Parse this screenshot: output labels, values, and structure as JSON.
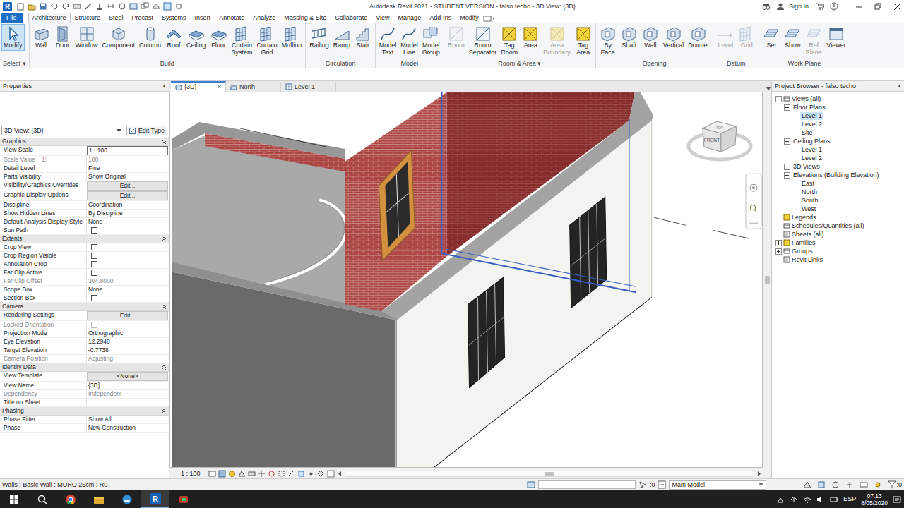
{
  "window": {
    "title": "Autodesk Revit 2021 - STUDENT VERSION - falso techo - 3D View: {3D}",
    "logo": "R",
    "sign_in": "Sign In"
  },
  "ribbon": {
    "app_button": {
      "label": "File"
    },
    "tabs": [
      {
        "label": "Architecture",
        "selected": true
      },
      {
        "label": "Structure",
        "selected": false
      },
      {
        "label": "Steel",
        "selected": false
      },
      {
        "label": "Precast",
        "selected": false
      },
      {
        "label": "Systems",
        "selected": false
      },
      {
        "label": "Insert",
        "selected": false
      },
      {
        "label": "Annotate",
        "selected": false
      },
      {
        "label": "Analyze",
        "selected": false
      },
      {
        "label": "Massing & Site",
        "selected": false
      },
      {
        "label": "Collaborate",
        "selected": false
      },
      {
        "label": "View",
        "selected": false
      },
      {
        "label": "Manage",
        "selected": false
      },
      {
        "label": "Add-Ins",
        "selected": false
      },
      {
        "label": "Modify",
        "selected": false
      }
    ],
    "panels": [
      {
        "label": "Select ▾",
        "buttons": [
          {
            "label": "Modify",
            "selected": true,
            "disabled": false
          }
        ]
      },
      {
        "label": "Build",
        "buttons": [
          {
            "label": "Wall",
            "selected": false,
            "disabled": false
          },
          {
            "label": "Door",
            "selected": false,
            "disabled": false
          },
          {
            "label": "Window",
            "selected": false,
            "disabled": false
          },
          {
            "label": "Component",
            "selected": false,
            "disabled": false
          },
          {
            "label": "Column",
            "selected": false,
            "disabled": false
          },
          {
            "label": "Roof",
            "selected": false,
            "disabled": false
          },
          {
            "label": "Ceiling",
            "selected": false,
            "disabled": false
          },
          {
            "label": "Floor",
            "selected": false,
            "disabled": false
          },
          {
            "label": "Curtain System",
            "selected": false,
            "disabled": false
          },
          {
            "label": "Curtain Grid",
            "selected": false,
            "disabled": false
          },
          {
            "label": "Mullion",
            "selected": false,
            "disabled": false
          }
        ]
      },
      {
        "label": "Circulation",
        "buttons": [
          {
            "label": "Railing",
            "selected": false,
            "disabled": false
          },
          {
            "label": "Ramp",
            "selected": false,
            "disabled": false
          },
          {
            "label": "Stair",
            "selected": false,
            "disabled": false
          }
        ]
      },
      {
        "label": "Model",
        "buttons": [
          {
            "label": "Model Text",
            "selected": false,
            "disabled": false
          },
          {
            "label": "Model Line",
            "selected": false,
            "disabled": false
          },
          {
            "label": "Model Group",
            "selected": false,
            "disabled": false
          }
        ]
      },
      {
        "label": "Room & Area ▾",
        "buttons": [
          {
            "label": "Room",
            "selected": false,
            "disabled": true
          },
          {
            "label": "Room Separator",
            "selected": false,
            "disabled": false
          },
          {
            "label": "Tag Room",
            "selected": false,
            "disabled": false
          },
          {
            "label": "Area",
            "selected": false,
            "disabled": false
          },
          {
            "label": "Area Boundary",
            "selected": false,
            "disabled": true
          },
          {
            "label": "Tag Area",
            "selected": false,
            "disabled": false
          }
        ]
      },
      {
        "label": "Opening",
        "buttons": [
          {
            "label": "By Face",
            "selected": false,
            "disabled": false
          },
          {
            "label": "Shaft",
            "selected": false,
            "disabled": false
          },
          {
            "label": "Wall",
            "selected": false,
            "disabled": false
          },
          {
            "label": "Vertical",
            "selected": false,
            "disabled": false
          },
          {
            "label": "Dormer",
            "selected": false,
            "disabled": false
          }
        ]
      },
      {
        "label": "Datum",
        "buttons": [
          {
            "label": "Level",
            "selected": false,
            "disabled": true
          },
          {
            "label": "Grid",
            "selected": false,
            "disabled": true
          }
        ]
      },
      {
        "label": "Work Plane",
        "buttons": [
          {
            "label": "Set",
            "selected": false,
            "disabled": false
          },
          {
            "label": "Show",
            "selected": false,
            "disabled": false
          },
          {
            "label": "Ref Plane",
            "selected": false,
            "disabled": true
          },
          {
            "label": "Viewer",
            "selected": false,
            "disabled": false
          }
        ]
      }
    ]
  },
  "properties": {
    "title": "Properties",
    "close": "×",
    "type_selector": "3D View: {3D}",
    "edit_type": "Edit Type",
    "groups": [
      {
        "name": "Graphics",
        "rows": [
          {
            "label": "View Scale",
            "value": "1 : 100",
            "kind": "input",
            "disabled": false
          },
          {
            "label": "Scale Value    1:",
            "value": "100",
            "kind": "text",
            "disabled": true
          },
          {
            "label": "Detail Level",
            "value": "Fine",
            "kind": "text",
            "disabled": false
          },
          {
            "label": "Parts Visibility",
            "value": "Show Original",
            "kind": "text",
            "disabled": false
          },
          {
            "label": "Visibility/Graphics Overrides",
            "value": "Edit...",
            "kind": "button",
            "disabled": false
          },
          {
            "label": "Graphic Display Options",
            "value": "Edit...",
            "kind": "button",
            "disabled": false
          },
          {
            "label": "Discipline",
            "value": "Coordination",
            "kind": "text",
            "disabled": false
          },
          {
            "label": "Show Hidden Lines",
            "value": "By Discipline",
            "kind": "text",
            "disabled": false
          },
          {
            "label": "Default Analysis Display Style",
            "value": "None",
            "kind": "text",
            "disabled": false
          },
          {
            "label": "Sun Path",
            "checked": false,
            "kind": "check",
            "disabled": false
          }
        ]
      },
      {
        "name": "Extents",
        "rows": [
          {
            "label": "Crop View",
            "checked": false,
            "kind": "check",
            "disabled": false
          },
          {
            "label": "Crop Region Visible",
            "checked": false,
            "kind": "check",
            "disabled": false
          },
          {
            "label": "Annotation Crop",
            "checked": false,
            "kind": "check",
            "disabled": false
          },
          {
            "label": "Far Clip Active",
            "checked": false,
            "kind": "check",
            "disabled": false
          },
          {
            "label": "Far Clip Offset",
            "value": "304.8000",
            "kind": "text",
            "disabled": true
          },
          {
            "label": "Scope Box",
            "value": "None",
            "kind": "text",
            "disabled": false
          },
          {
            "label": "Section Box",
            "checked": false,
            "kind": "check",
            "disabled": false
          }
        ]
      },
      {
        "name": "Camera",
        "rows": [
          {
            "label": "Rendering Settings",
            "value": "Edit...",
            "kind": "button",
            "disabled": false
          },
          {
            "label": "Locked Orientation",
            "checked": false,
            "kind": "check",
            "disabled": true
          },
          {
            "label": "Projection Mode",
            "value": "Orthographic",
            "kind": "text",
            "disabled": false
          },
          {
            "label": "Eye Elevation",
            "value": "12.2948",
            "kind": "text",
            "disabled": false
          },
          {
            "label": "Target Elevation",
            "value": "-0.7738",
            "kind": "text",
            "disabled": false
          },
          {
            "label": "Camera Position",
            "value": "Adjusting",
            "kind": "text",
            "disabled": true
          }
        ]
      },
      {
        "name": "Identity Data",
        "rows": [
          {
            "label": "View Template",
            "value": "<None>",
            "kind": "button",
            "disabled": false
          },
          {
            "label": "View Name",
            "value": "{3D}",
            "kind": "text",
            "disabled": false
          },
          {
            "label": "Dependency",
            "value": "Independent",
            "kind": "text",
            "disabled": true
          },
          {
            "label": "Title on Sheet",
            "value": "",
            "kind": "text",
            "disabled": false
          }
        ]
      },
      {
        "name": "Phasing",
        "rows": [
          {
            "label": "Phase Filter",
            "value": "Show All",
            "kind": "text",
            "disabled": false
          },
          {
            "label": "Phase",
            "value": "New Construction",
            "kind": "text",
            "disabled": false
          }
        ]
      }
    ]
  },
  "view_tabs": [
    {
      "label": "{3D}",
      "selected": true,
      "close": "×"
    },
    {
      "label": "North",
      "selected": false
    },
    {
      "label": "Level 1",
      "selected": false
    }
  ],
  "view": {
    "cube_front": "FRONT",
    "cube_top": "TOP",
    "scale": "1 : 100",
    "scroll": {
      "vertical": 0.5,
      "horizontal": 0.5
    }
  },
  "project_browser": {
    "title": "Project Browser - falso techo",
    "close": "×",
    "items": [
      {
        "label": "Views (all)",
        "depth": 0,
        "expanded": true,
        "selected": false
      },
      {
        "label": "Floor Plans",
        "depth": 1,
        "expanded": true,
        "selected": false
      },
      {
        "label": "Level 1",
        "depth": 2,
        "selected": true
      },
      {
        "label": "Level 2",
        "depth": 2,
        "selected": false
      },
      {
        "label": "Site",
        "depth": 2,
        "selected": false
      },
      {
        "label": "Ceiling Plans",
        "depth": 1,
        "expanded": true,
        "selected": false
      },
      {
        "label": "Level 1",
        "depth": 2,
        "selected": false
      },
      {
        "label": "Level 2",
        "depth": 2,
        "selected": false
      },
      {
        "label": "3D Views",
        "depth": 1,
        "expanded": false,
        "selected": false
      },
      {
        "label": "Elevations (Building Elevation)",
        "depth": 1,
        "expanded": true,
        "selected": false
      },
      {
        "label": "East",
        "depth": 2,
        "selected": false
      },
      {
        "label": "North",
        "depth": 2,
        "selected": false
      },
      {
        "label": "South",
        "depth": 2,
        "selected": false
      },
      {
        "label": "West",
        "depth": 2,
        "selected": false
      },
      {
        "label": "Legends",
        "depth": 0,
        "selected": false
      },
      {
        "label": "Schedules/Quantities (all)",
        "depth": 0,
        "selected": false
      },
      {
        "label": "Sheets (all)",
        "depth": 0,
        "selected": false
      },
      {
        "label": "Families",
        "depth": 0,
        "expanded": false,
        "selected": false
      },
      {
        "label": "Groups",
        "depth": 0,
        "expanded": false,
        "selected": false
      },
      {
        "label": "Revit Links",
        "depth": 0,
        "selected": false
      }
    ]
  },
  "status_bar": {
    "text": "Walls : Basic Wall : MURO 25cm : R0",
    "selection_count": ":0",
    "design_option": "Main Model",
    "filter_count": ":0"
  },
  "taskbar": {
    "language": "ESP",
    "time": "07:13",
    "date": "8/05/2020"
  }
}
